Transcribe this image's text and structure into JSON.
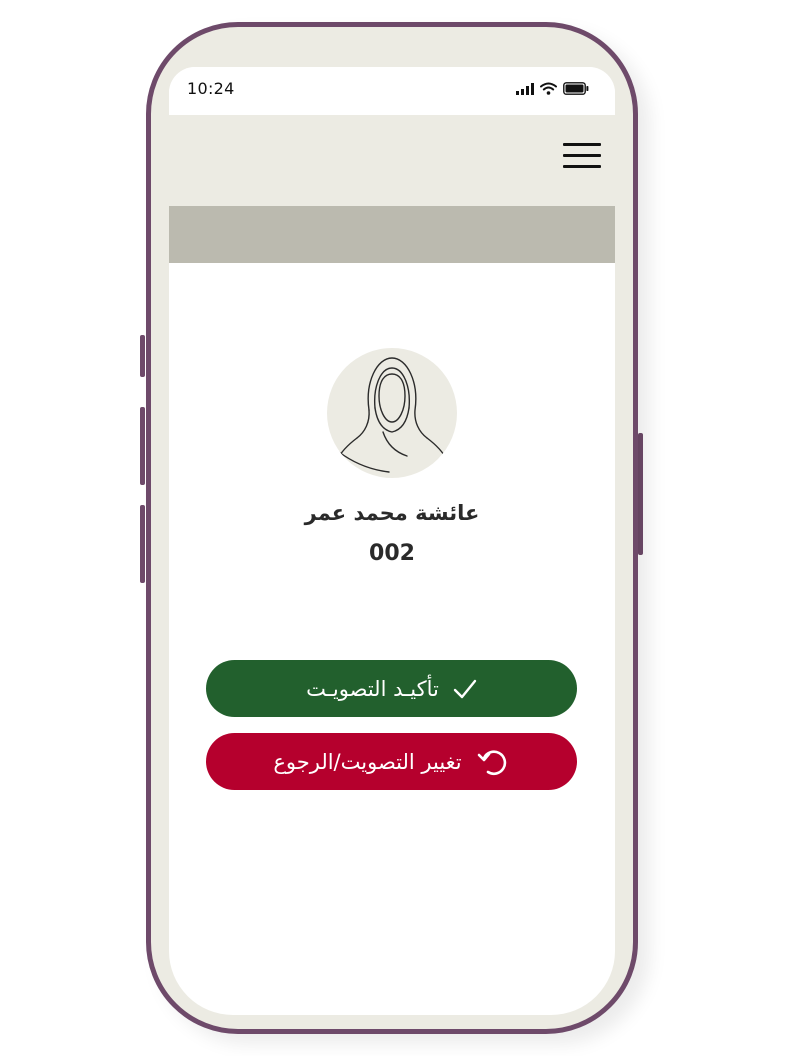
{
  "status_bar": {
    "time": "10:24",
    "icons": [
      "signal-icon",
      "wifi-icon",
      "battery-icon"
    ]
  },
  "header": {
    "menu_icon": "hamburger-menu-icon"
  },
  "voter": {
    "name": "عائشة محمد عمر",
    "number": "002",
    "avatar_icon": "hijab-woman-avatar-icon"
  },
  "actions": {
    "confirm_label": "تأكيـد التصويـت",
    "confirm_icon": "checkmark-icon",
    "change_label": "تغيير التصويت/الرجوع",
    "change_icon": "undo-arrow-icon"
  },
  "colors": {
    "frame": "#6e4a6a",
    "header_bg": "#ecebe3",
    "band_bg": "#bbbaaf",
    "confirm_bg": "#22602d",
    "change_bg": "#b5002d"
  }
}
